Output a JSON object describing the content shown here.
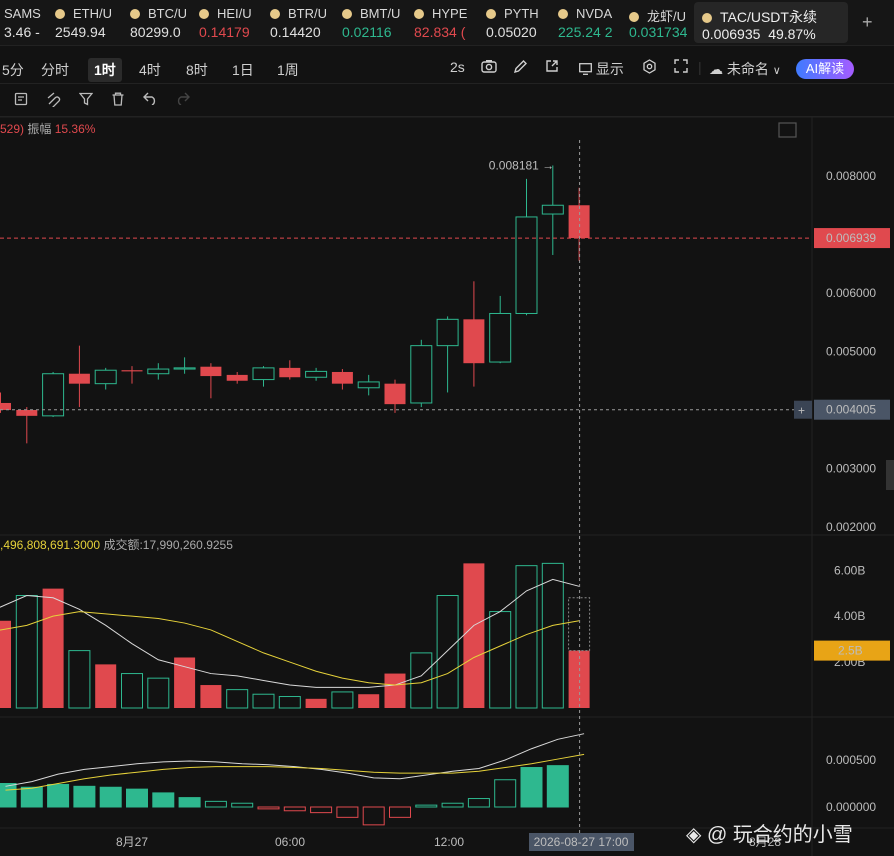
{
  "ticker": [
    {
      "name": "SAMS",
      "price": "3.46 -",
      "dir": "flat"
    },
    {
      "name": "ETH/U",
      "price": "2549.94",
      "dir": "flat"
    },
    {
      "name": "BTC/U",
      "price": "80299.0",
      "dir": "flat"
    },
    {
      "name": "HEI/U",
      "price": "0.14179",
      "dir": "dn"
    },
    {
      "name": "BTR/U",
      "price": "0.14420",
      "dir": "flat"
    },
    {
      "name": "BMT/U",
      "price": "0.02116",
      "dir": "up"
    },
    {
      "name": "HYPE",
      "price": "82.834 (",
      "dir": "dn"
    },
    {
      "name": "PYTH",
      "price": "0.05020",
      "dir": "flat"
    },
    {
      "name": "NVDA",
      "price": "225.24 2",
      "dir": "up"
    },
    {
      "name": "龙虾/U",
      "price": "0.031734",
      "dir": "up"
    }
  ],
  "active_symbol": {
    "name": "TAC/USDT永续",
    "price": "0.006935",
    "change": "49.87%"
  },
  "timeframes": [
    "5分",
    "分时",
    "1时",
    "4时",
    "8时",
    "1日",
    "1周"
  ],
  "selected_timeframe": "1时",
  "toolbar": {
    "refresh": "2s",
    "display": "显示",
    "layout_name": "未命名",
    "ai_label": "AI解读"
  },
  "info_line": {
    "prefix": "529)",
    "amp_label": "振幅",
    "amp_value": "15.36%"
  },
  "volume_info": {
    "volume": ",496,808,691.3000",
    "turnover_label": "成交额:",
    "turnover": "17,990,260.9255"
  },
  "price_axis": [
    "0.008000",
    "0.006000",
    "0.005000",
    "0.003000",
    "0.002000"
  ],
  "current_price_tag": "0.006939",
  "crosshair_price_tag": "0.004005",
  "high_marker": "0.008181",
  "volume_axis": [
    "6.00B",
    "4.00B",
    "2.00B"
  ],
  "volume_tag": "2.5B",
  "indicator_axis": [
    "0.000500",
    "0.000000"
  ],
  "x_labels": [
    "8月27",
    "06:00",
    "12:00",
    "8月28"
  ],
  "crosshair_time": "2026-08-27 17:00",
  "watermark": "@ 玩合约的小雪",
  "colors": {
    "up": "#2eb88f",
    "down": "#e0494e",
    "ma1": "#d9d9d9",
    "ma2": "#e6d23a",
    "tag": "#e0494e",
    "vol_tag": "#e8a416"
  },
  "chart_data": {
    "type": "candlestick",
    "ylim": [
      0.0018,
      0.0086
    ],
    "candles": [
      {
        "o": 0.00412,
        "h": 0.0043,
        "l": 0.00395,
        "c": 0.004
      },
      {
        "o": 0.004,
        "h": 0.00405,
        "l": 0.00343,
        "c": 0.0039
      },
      {
        "o": 0.0039,
        "h": 0.00465,
        "l": 0.00388,
        "c": 0.00462
      },
      {
        "o": 0.00462,
        "h": 0.0051,
        "l": 0.00405,
        "c": 0.00445
      },
      {
        "o": 0.00445,
        "h": 0.00472,
        "l": 0.00435,
        "c": 0.00468
      },
      {
        "o": 0.00468,
        "h": 0.00475,
        "l": 0.00445,
        "c": 0.00466
      },
      {
        "o": 0.00462,
        "h": 0.0048,
        "l": 0.00452,
        "c": 0.0047
      },
      {
        "o": 0.0047,
        "h": 0.0049,
        "l": 0.00462,
        "c": 0.00472
      },
      {
        "o": 0.00474,
        "h": 0.0048,
        "l": 0.0042,
        "c": 0.00458
      },
      {
        "o": 0.0046,
        "h": 0.00465,
        "l": 0.00445,
        "c": 0.0045
      },
      {
        "o": 0.00452,
        "h": 0.00475,
        "l": 0.0044,
        "c": 0.00472
      },
      {
        "o": 0.00472,
        "h": 0.00485,
        "l": 0.00452,
        "c": 0.00456
      },
      {
        "o": 0.00456,
        "h": 0.00472,
        "l": 0.0045,
        "c": 0.00466
      },
      {
        "o": 0.00465,
        "h": 0.0047,
        "l": 0.00435,
        "c": 0.00445
      },
      {
        "o": 0.00438,
        "h": 0.0046,
        "l": 0.00425,
        "c": 0.00448
      },
      {
        "o": 0.00445,
        "h": 0.00452,
        "l": 0.00395,
        "c": 0.0041
      },
      {
        "o": 0.00412,
        "h": 0.0052,
        "l": 0.00405,
        "c": 0.0051
      },
      {
        "o": 0.0051,
        "h": 0.0056,
        "l": 0.0043,
        "c": 0.00555
      },
      {
        "o": 0.00555,
        "h": 0.0062,
        "l": 0.0044,
        "c": 0.0048
      },
      {
        "o": 0.00482,
        "h": 0.00595,
        "l": 0.0048,
        "c": 0.00565
      },
      {
        "o": 0.00565,
        "h": 0.00795,
        "l": 0.00562,
        "c": 0.0073
      },
      {
        "o": 0.00735,
        "h": 0.00818,
        "l": 0.00665,
        "c": 0.0075
      },
      {
        "o": 0.0075,
        "h": 0.0078,
        "l": 0.00655,
        "c": 0.00694
      }
    ],
    "volumes": [
      3.9,
      3.8,
      4.9,
      5.2,
      2.5,
      1.9,
      1.5,
      1.3,
      2.2,
      1.0,
      0.8,
      0.6,
      0.5,
      0.4,
      0.7,
      0.6,
      1.5,
      2.4,
      4.9,
      6.3,
      4.2,
      6.2,
      6.3,
      2.5
    ],
    "volume_up": [
      false,
      false,
      true,
      false,
      true,
      false,
      true,
      true,
      false,
      false,
      true,
      true,
      true,
      false,
      true,
      false,
      false,
      true,
      true,
      false,
      true,
      true,
      true,
      false
    ],
    "volume_ylim": [
      0,
      7.1
    ],
    "macd_hist": [
      0.00025,
      0.00021,
      0.00024,
      0.00022,
      0.00021,
      0.00019,
      0.00015,
      0.0001,
      6e-05,
      4e-05,
      -2e-05,
      -4e-05,
      -6e-05,
      -0.00011,
      -0.00019,
      -0.00011,
      2e-05,
      4e-05,
      9e-05,
      0.00029,
      0.00042,
      0.00044
    ],
    "macd_ylim": [
      -0.0002,
      0.0008
    ]
  }
}
